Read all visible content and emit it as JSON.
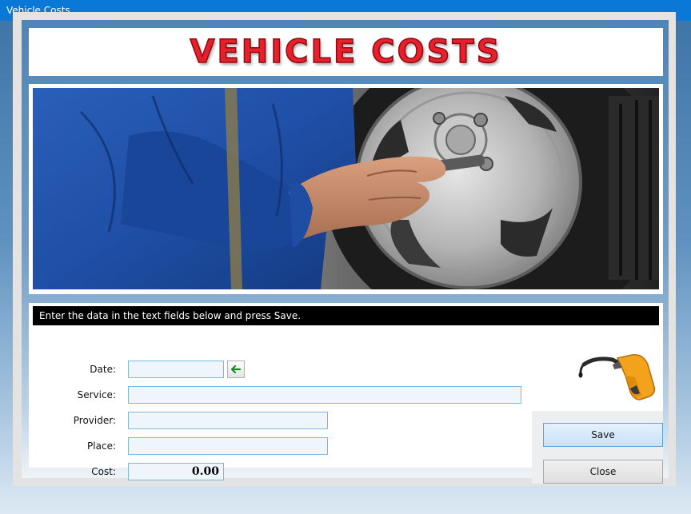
{
  "window": {
    "title": "Vehicle Costs"
  },
  "banner": {
    "title": "VEHICLE COSTS"
  },
  "instruction": "Enter the data in the text fields below and press Save.",
  "form": {
    "date": {
      "label": "Date:",
      "value": ""
    },
    "service": {
      "label": "Service:",
      "value": ""
    },
    "provider": {
      "label": "Provider:",
      "value": ""
    },
    "place": {
      "label": "Place:",
      "value": ""
    },
    "cost": {
      "label": "Cost:",
      "value": "0.00"
    }
  },
  "buttons": {
    "save": "Save",
    "close": "Close"
  },
  "colors": {
    "titlebar": "#0a78d7",
    "banner_text": "#e8202c",
    "field_bg": "#eef6fc",
    "field_border": "#7fb6dc",
    "save_button": "#c7e1f8"
  },
  "icons": {
    "date_picker": "arrow-left-icon",
    "fuel": "fuel-nozzle-icon"
  }
}
